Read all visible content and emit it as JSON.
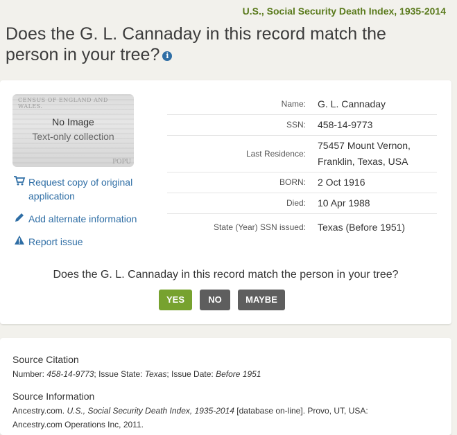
{
  "collection_title": "U.S., Social Security Death Index, 1935-2014",
  "page_question": "Does the G. L. Cannaday in this record match the person in your tree?",
  "info_icon_glyph": "i",
  "thumbnail": {
    "census_text": "CENSUS OF ENGLAND AND WALES.",
    "no_image": "No Image",
    "text_only": "Text-only collection",
    "corner_text": "POPU"
  },
  "actions": {
    "request_copy": "Request copy of original application",
    "add_alternate": "Add alternate information",
    "report_issue": "Report issue"
  },
  "facts": [
    {
      "label": "Name:",
      "value": "G. L. Cannaday"
    },
    {
      "label": "SSN:",
      "value": "458-14-9773"
    },
    {
      "label": "Last Residence:",
      "value": "75457 Mount Vernon, Franklin, Texas, USA"
    },
    {
      "label": "BORN:",
      "value": "2 Oct 1916"
    },
    {
      "label": "Died:",
      "value": "10 Apr 1988"
    },
    {
      "label": "State (Year) SSN issued:",
      "value": "Texas (Before 1951)"
    }
  ],
  "match": {
    "question": "Does the G. L. Cannaday in this record match the person in your tree?",
    "yes": "YES",
    "no": "NO",
    "maybe": "MAYBE"
  },
  "source": {
    "citation_heading": "Source Citation",
    "citation": {
      "number_label": "Number: ",
      "number": "458-14-9773",
      "state_label": "; Issue State: ",
      "state": "Texas",
      "date_label": "; Issue Date: ",
      "date": "Before 1951"
    },
    "info_heading": "Source Information",
    "info": {
      "prefix": "Ancestry.com. ",
      "title": "U.S., Social Security Death Index, 1935-2014",
      "suffix": " [database on-line]. Provo, UT, USA: Ancestry.com Operations Inc, 2011."
    }
  },
  "colors": {
    "accent_green": "#77a22f",
    "title_green": "#5a7a1c",
    "link_blue": "#2f6ea5",
    "button_gray": "#5e5e5e"
  }
}
